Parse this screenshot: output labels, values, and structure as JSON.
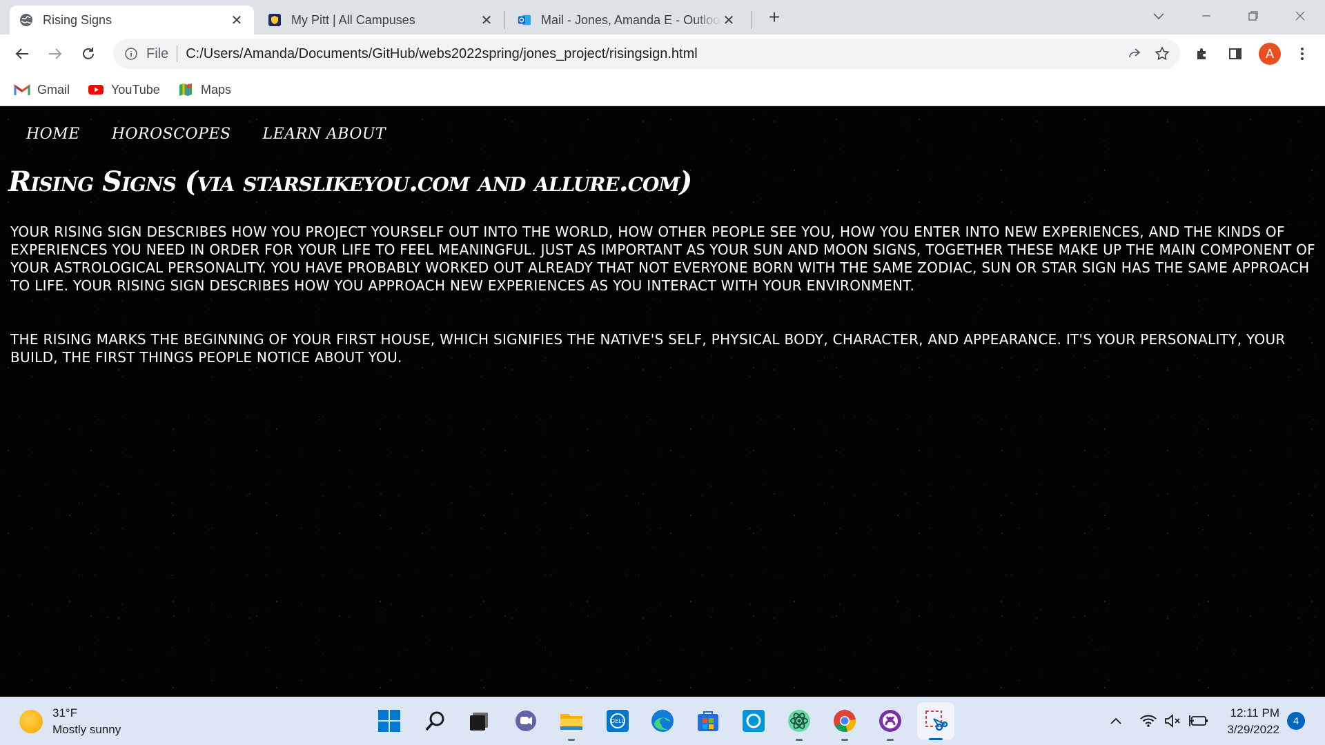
{
  "browser": {
    "tabs": [
      {
        "title": "Rising Signs",
        "favicon": "globe-icon",
        "active": true
      },
      {
        "title": "My Pitt | All Campuses",
        "favicon": "pitt-shield-icon",
        "active": false
      },
      {
        "title": "Mail - Jones, Amanda E - Outlook",
        "favicon": "outlook-icon",
        "active": false
      }
    ],
    "new_tab_label": "+",
    "address": {
      "scheme_label": "File",
      "url": "C:/Users/Amanda/Documents/GitHub/webs2022spring/jones_project/risingsign.html"
    },
    "profile_initial": "A",
    "bookmarks": [
      {
        "label": "Gmail",
        "icon": "gmail-icon"
      },
      {
        "label": "YouTube",
        "icon": "youtube-icon"
      },
      {
        "label": "Maps",
        "icon": "maps-icon"
      }
    ]
  },
  "site": {
    "nav": [
      "HOME",
      "HOROSCOPES",
      "LEARN ABOUT"
    ],
    "headline": "Rising Signs (via starslikeyou.com and allure.com)",
    "paragraphs": [
      "Your Rising Sign describes how you project yourself out into the world, how other people see you, how you enter into new experiences, and the kinds of experiences you need in order for your life to feel meaningful. Just as important as your Sun and Moon signs, together these make up the main component of your astrological personality. You have probably worked out already that not everyone born with the same zodiac, sun or star sign has the same approach to life. Your Rising Sign describes how you approach new experiences as you interact with your environment.",
      "The rising marks the beginning of your first house, which signifies the native's self, physical body, character, and appearance. It's your personality, your build, the first things people notice about you."
    ]
  },
  "taskbar": {
    "weather_temp": "31°F",
    "weather_desc": "Mostly sunny",
    "time": "12:11 PM",
    "date": "3/29/2022",
    "notification_count": "4"
  },
  "colors": {
    "page_bg": "#030303",
    "tabstrip_bg": "#dee1e6",
    "taskbar_bg": "#dce6f4",
    "accent_blue": "#0067c0",
    "avatar_orange": "#e8501f"
  }
}
